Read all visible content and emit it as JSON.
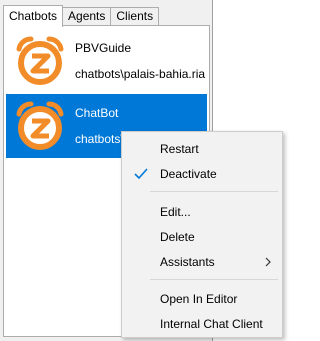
{
  "tabs": [
    {
      "label": "Chatbots"
    },
    {
      "label": "Agents"
    },
    {
      "label": "Clients"
    }
  ],
  "chatbots": [
    {
      "name": "PBVGuide",
      "path": "chatbots\\palais-bahia.ria",
      "selected": false
    },
    {
      "name": "ChatBot",
      "path": "chatbots\\",
      "selected": true
    }
  ],
  "logo": {
    "letter": "Z",
    "color": "#f28c28",
    "icon": "alarm-clock-z-logo"
  },
  "context_menu": {
    "items": [
      {
        "label": "Restart"
      },
      {
        "label": "Deactivate",
        "checked": true
      },
      {
        "label": "Edit..."
      },
      {
        "label": "Delete"
      },
      {
        "label": "Assistants",
        "submenu": true
      },
      {
        "label": "Open In Editor"
      },
      {
        "label": "Internal Chat Client"
      }
    ]
  },
  "colors": {
    "selection": "#0078d7",
    "check": "#0078d7"
  }
}
